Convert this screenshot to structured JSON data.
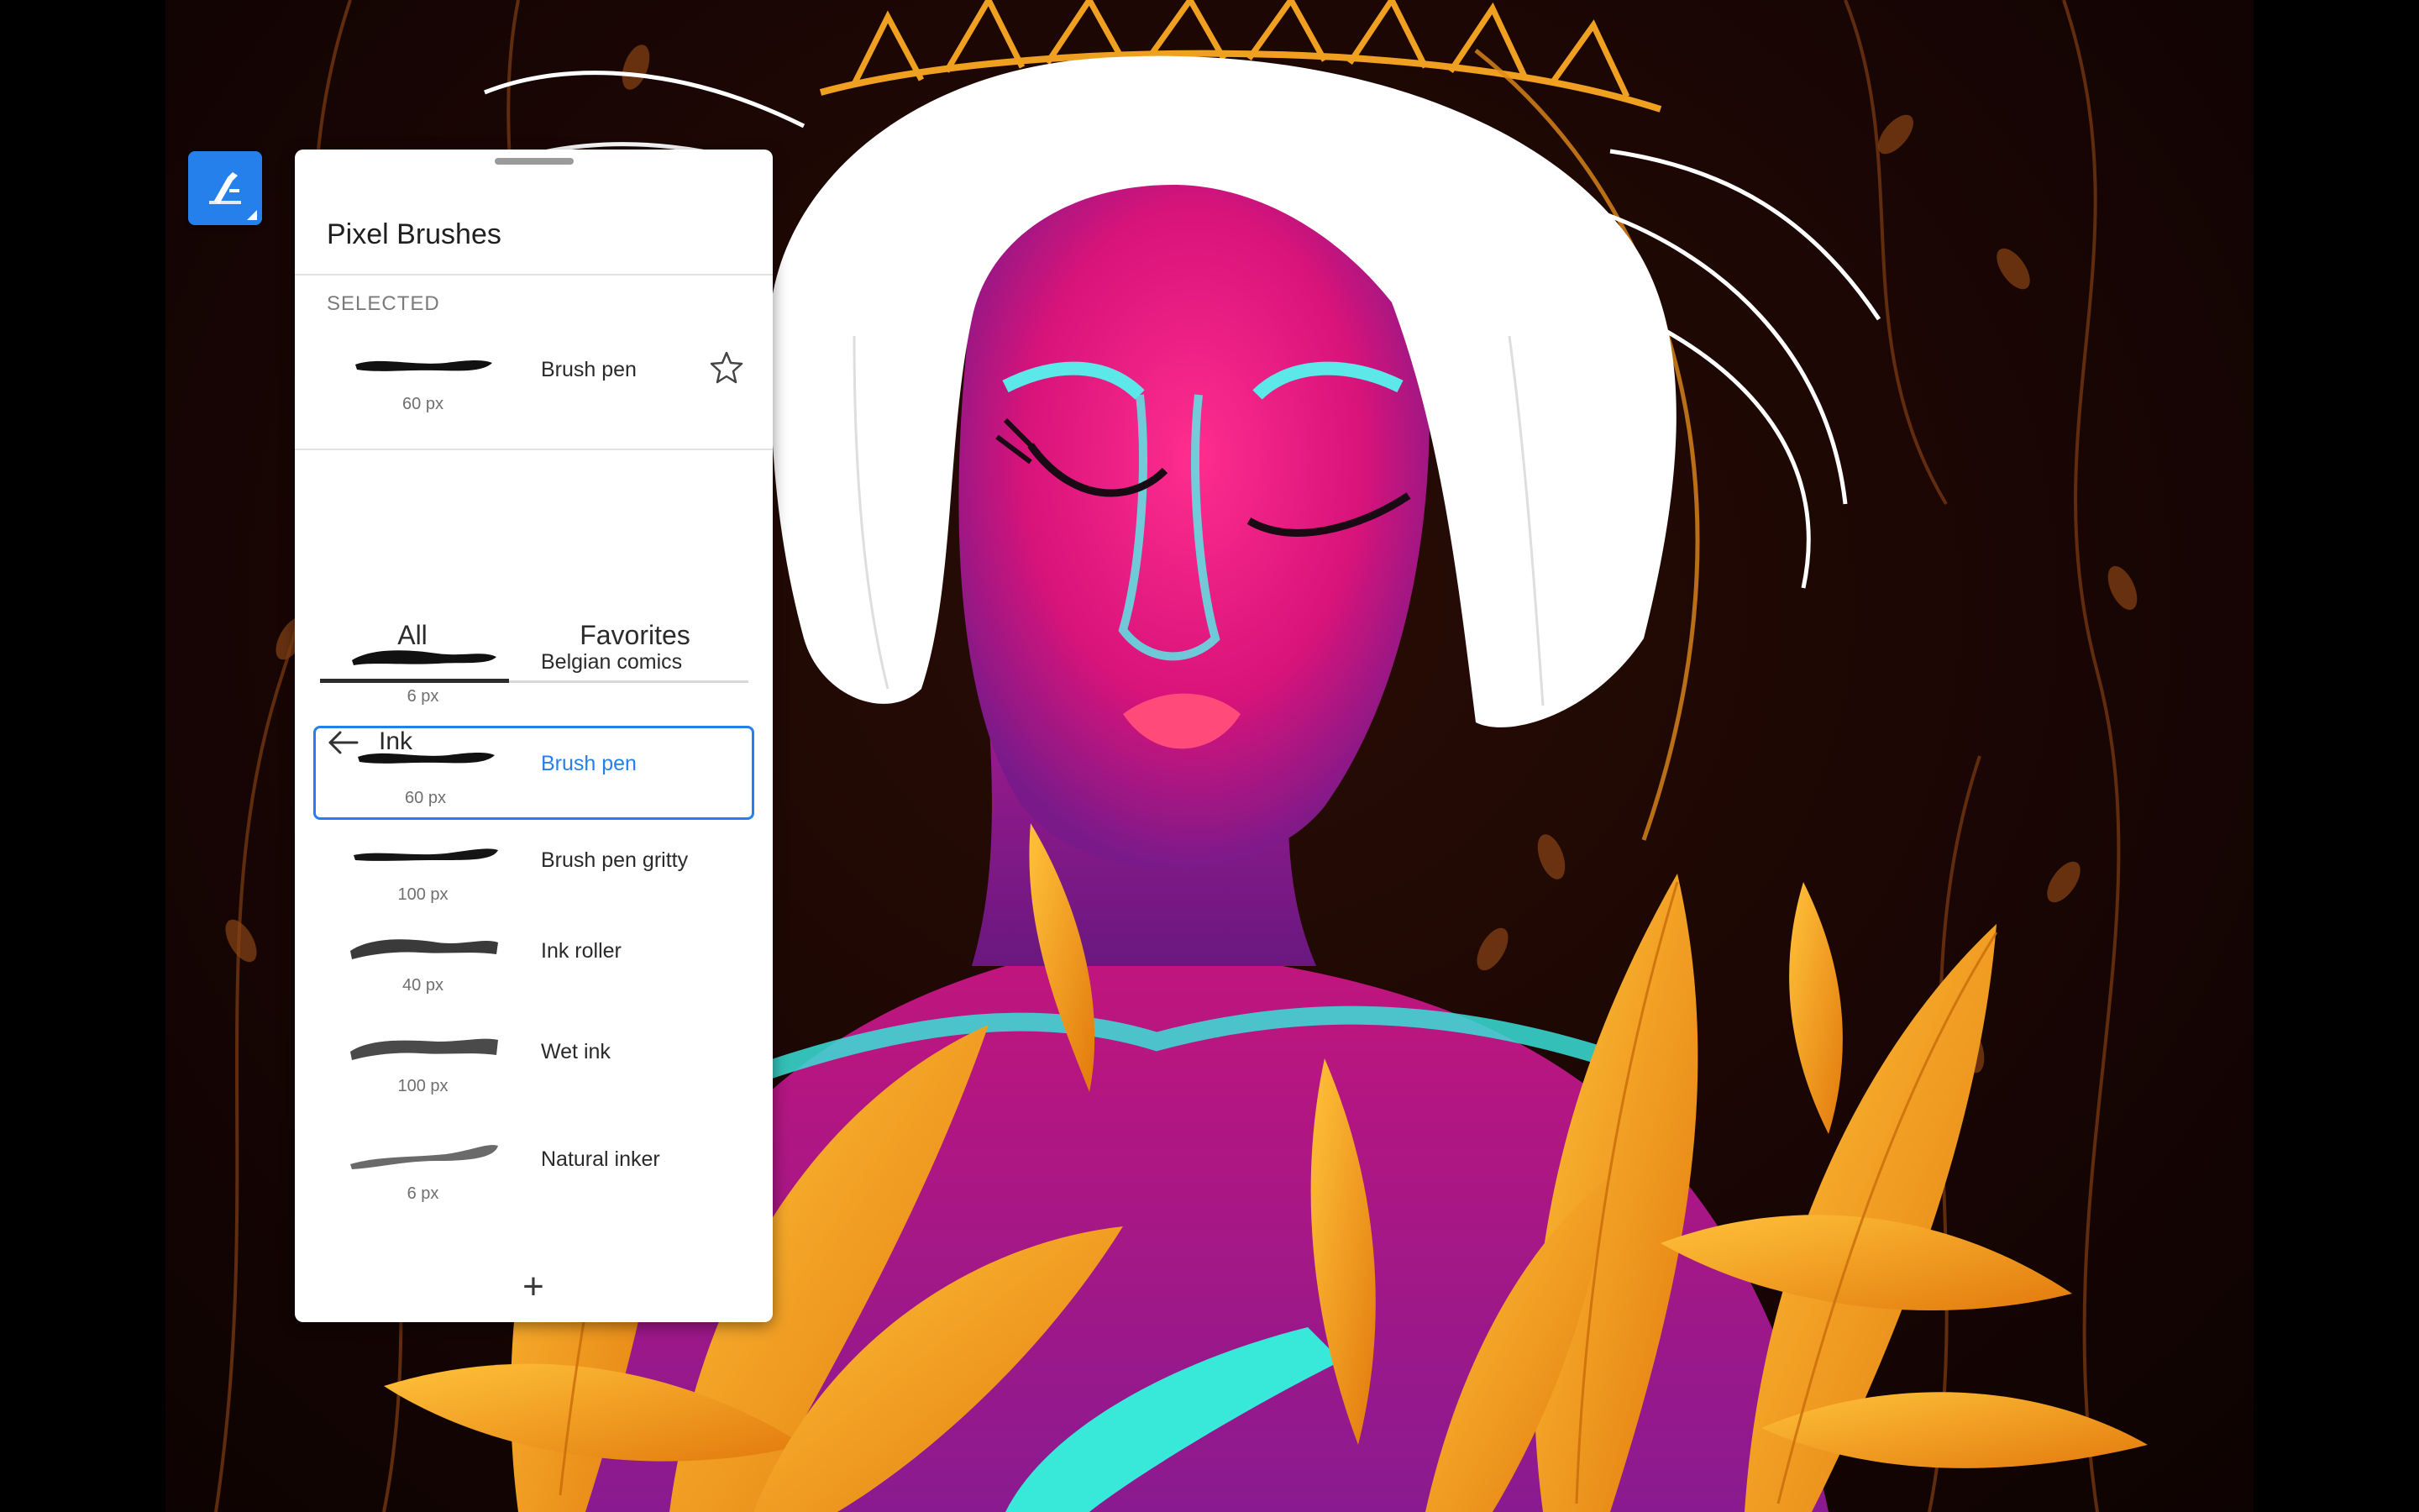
{
  "panel": {
    "title": "Pixel Brushes",
    "selected_label": "SELECTED",
    "selected_brush": {
      "name": "Brush pen",
      "size": "60 px"
    },
    "tabs": [
      {
        "label": "All",
        "active": true
      },
      {
        "label": "Favorites",
        "active": false
      }
    ],
    "category": "Ink",
    "brushes": [
      {
        "name": "Belgian comics",
        "size": "6 px",
        "active": false
      },
      {
        "name": "Brush pen",
        "size": "60 px",
        "active": true
      },
      {
        "name": "Brush pen gritty",
        "size": "100 px",
        "active": false
      },
      {
        "name": "Ink roller",
        "size": "40 px",
        "active": false
      },
      {
        "name": "Wet ink",
        "size": "100 px",
        "active": false
      },
      {
        "name": "Natural inker",
        "size": "6 px",
        "active": false
      }
    ],
    "add_label": "+"
  },
  "icons": {
    "tool": "brush-tool-icon",
    "favorite": "star-icon",
    "back": "arrow-left-icon",
    "add": "plus-icon"
  },
  "colors": {
    "accent": "#2680eb",
    "panel_bg": "#ffffff",
    "canvas_bg": "#1a0604",
    "skin_pink": "#e0187a",
    "hair_white": "#ffffff",
    "leaf_orange": "#f0a020",
    "cyan": "#38e0d8"
  }
}
